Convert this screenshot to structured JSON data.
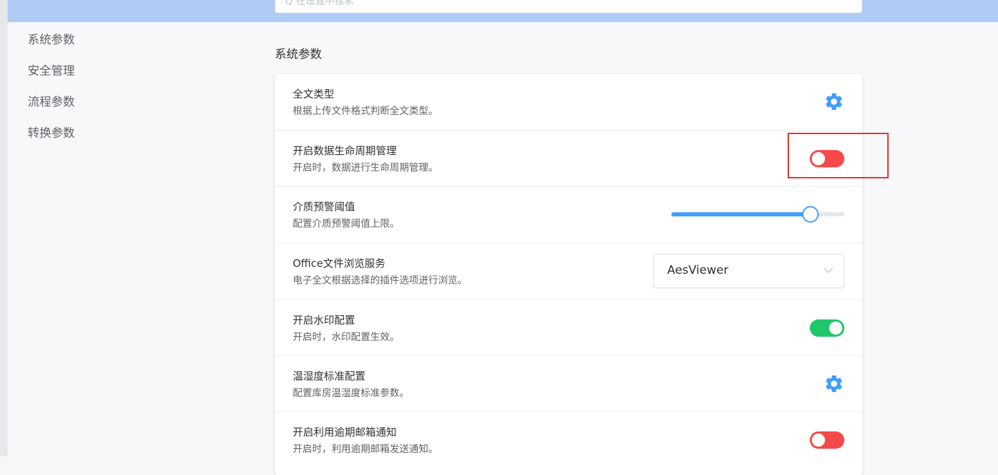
{
  "search": {
    "placeholder": "Q 在设置中搜索"
  },
  "sidebar": {
    "items": [
      {
        "label": "系统参数"
      },
      {
        "label": "安全管理"
      },
      {
        "label": "流程参数"
      },
      {
        "label": "转换参数"
      }
    ]
  },
  "section": {
    "title": "系统参数"
  },
  "settings": [
    {
      "title": "全文类型",
      "desc": "根据上传文件格式判断全文类型。",
      "control": "gear-icon"
    },
    {
      "title": "开启数据生命周期管理",
      "desc": "开启时，数据进行生命周期管理。",
      "control": "toggle",
      "state": "off"
    },
    {
      "title": "介质预警阈值",
      "desc": "配置介质预警阈值上限。",
      "control": "slider",
      "value_fraction": 0.8
    },
    {
      "title": "Office文件浏览服务",
      "desc": "电子全文根据选择的插件选项进行浏览。",
      "control": "select",
      "value": "AesViewer"
    },
    {
      "title": "开启水印配置",
      "desc": "开启时，水印配置生效。",
      "control": "toggle",
      "state": "on"
    },
    {
      "title": "温湿度标准配置",
      "desc": "配置库房温湿度标准参数。",
      "control": "gear-icon"
    },
    {
      "title": "开启利用逾期邮箱通知",
      "desc": "开启时，利用逾期邮箱发送通知。",
      "control": "toggle",
      "state": "off"
    }
  ],
  "colors": {
    "accent": "#409eff",
    "toggle_off": "#f5494a",
    "toggle_on": "#1ec86a",
    "highlight_border": "#e5312c",
    "top_band": "#aecbf5"
  }
}
